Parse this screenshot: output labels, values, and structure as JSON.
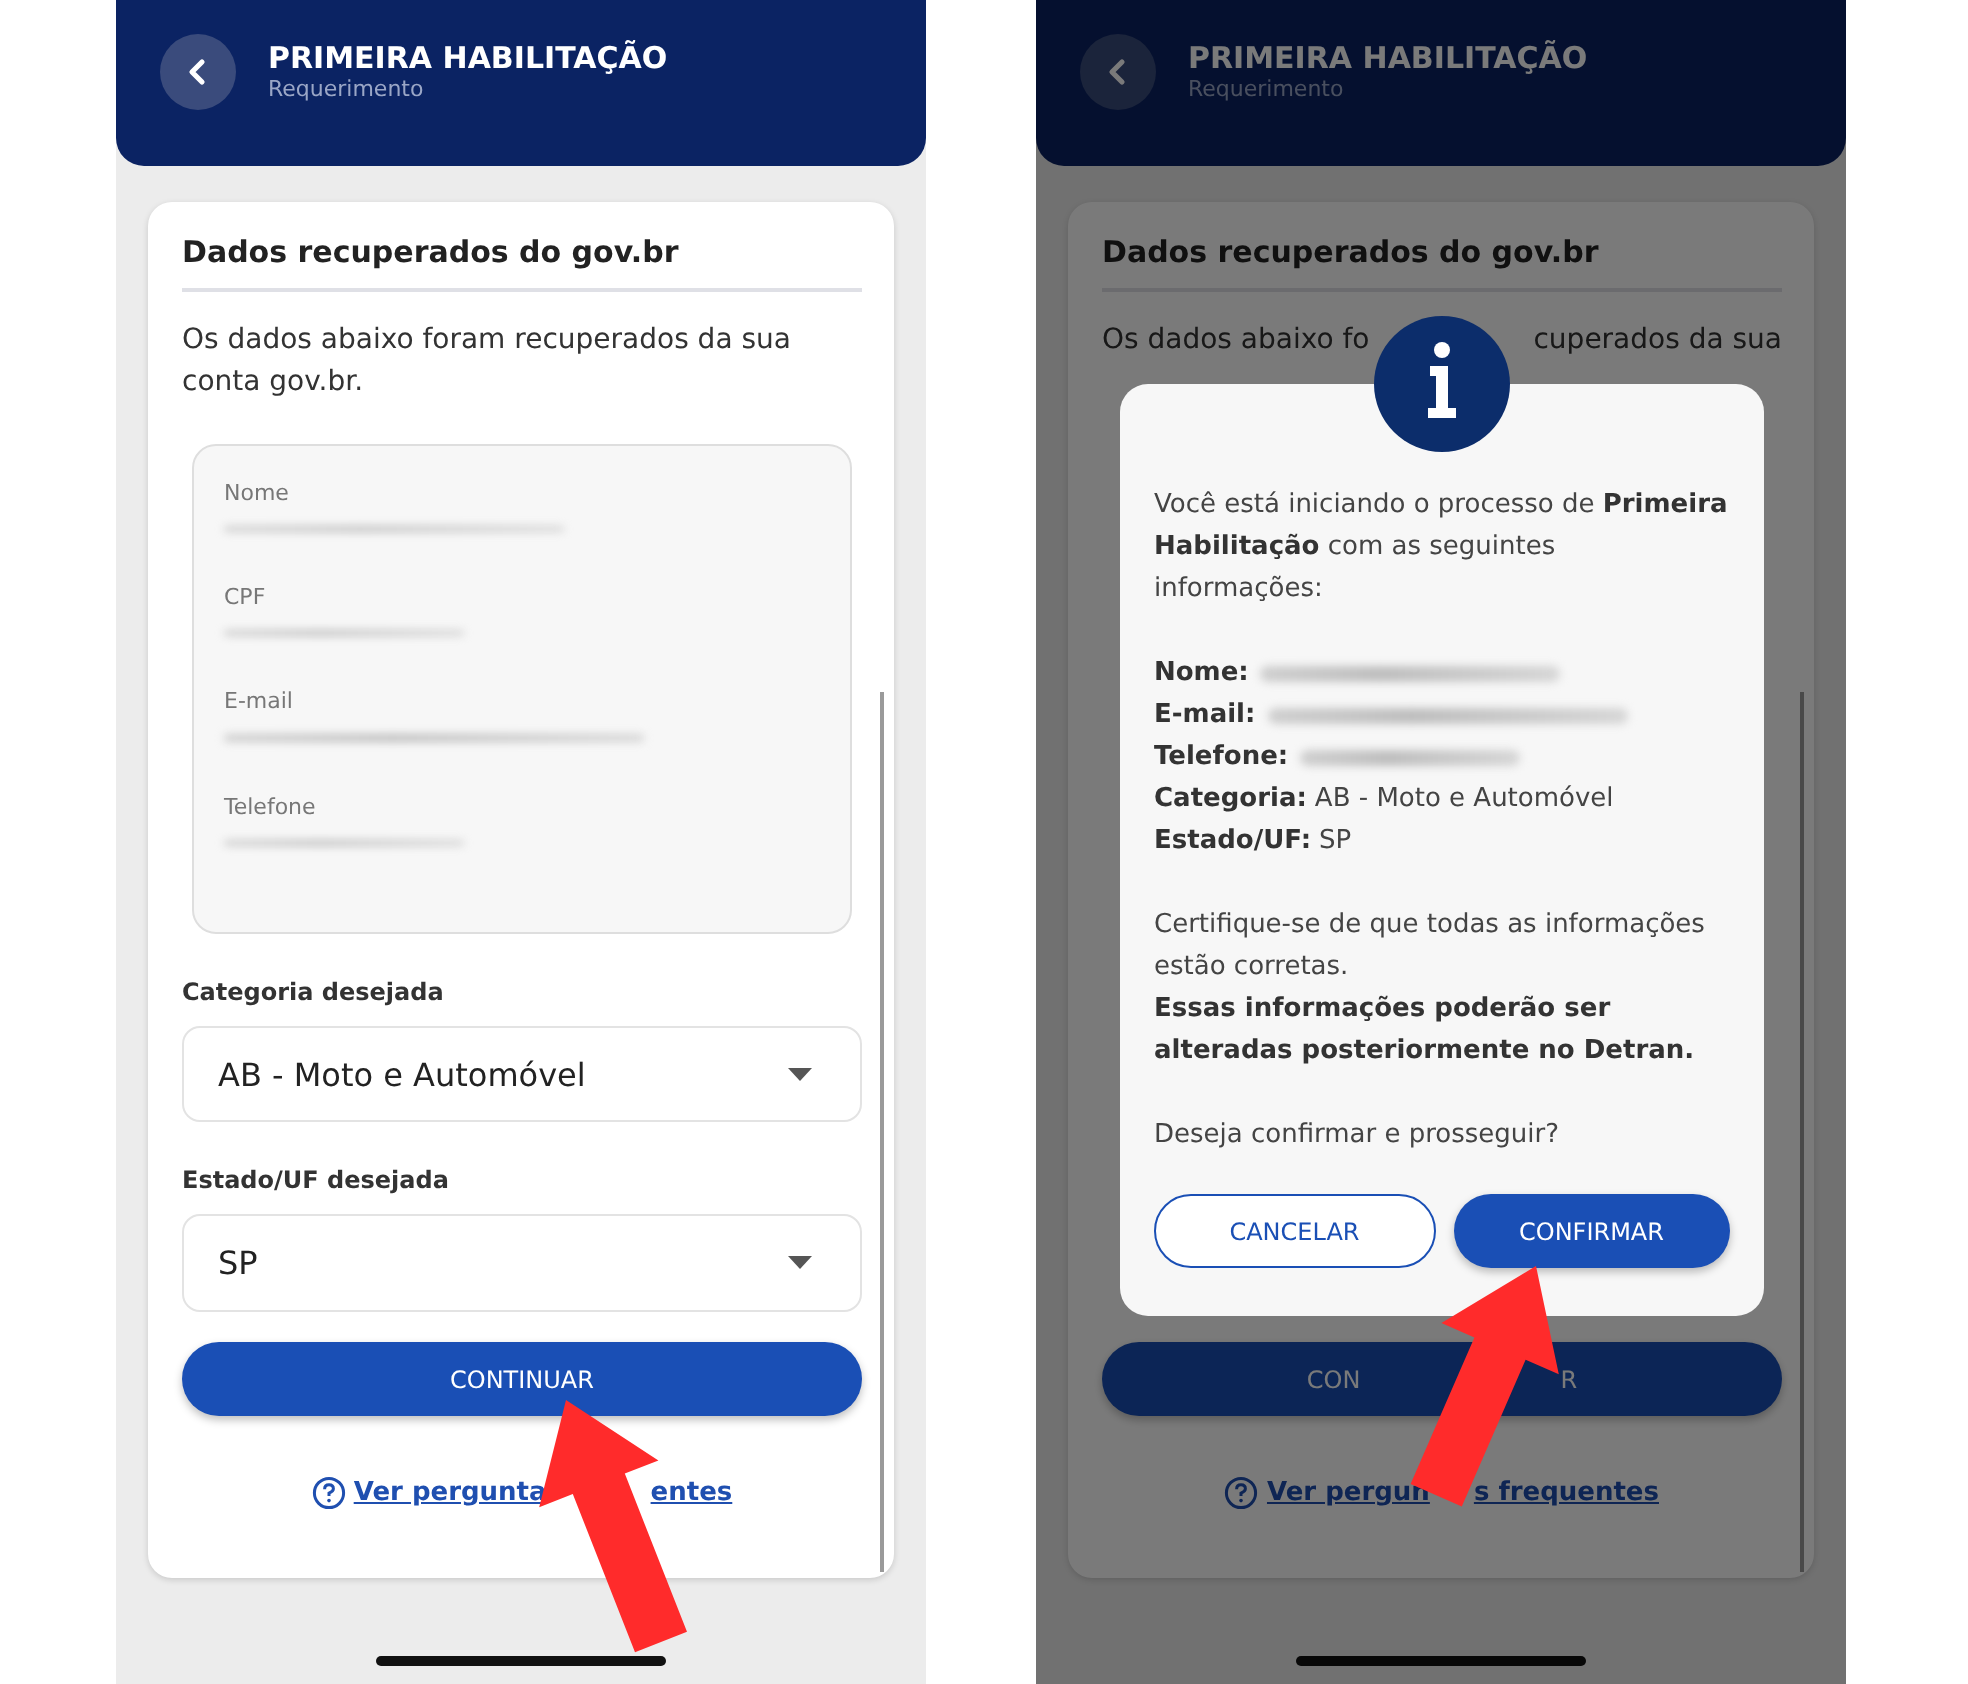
{
  "screens": [
    {
      "kind": "form",
      "header": {
        "title": "PRIMEIRA HABILITAÇÃO",
        "subtitle": "Requerimento"
      },
      "card": {
        "heading": "Dados recuperados do gov.br",
        "intro": "Os dados abaixo foram recuperados da sua conta gov.br.",
        "fields": [
          {
            "label": "Nome"
          },
          {
            "label": "CPF"
          },
          {
            "label": "E-mail"
          },
          {
            "label": "Telefone"
          }
        ],
        "selects": [
          {
            "label": "Categoria desejada",
            "value": "AB - Moto e Automóvel"
          },
          {
            "label": "Estado/UF desejada",
            "value": "SP"
          }
        ],
        "button": [
          "CONTINUAR"
        ],
        "link": [
          "Ver pergunta",
          "entes"
        ]
      }
    },
    {
      "kind": "dialog",
      "header": {
        "title": "PRIMEIRA HABILITAÇÃO",
        "subtitle": "Requerimento"
      },
      "card": {
        "heading": "Dados recuperados do gov.br",
        "intro_parts": [
          "Os dados abaixo fo",
          "cuperados da sua"
        ],
        "button": [
          "CON",
          "R"
        ],
        "link": [
          "Ver pergun",
          "s frequentes"
        ]
      },
      "dialog": {
        "intro": "Você está iniciando o processo de **Primeira Habilitação** com as seguintes informações:",
        "summary": [
          {
            "label": "Nome:",
            "kind": "redacted"
          },
          {
            "label": "E-mail:",
            "kind": "redacted"
          },
          {
            "label": "Telefone:",
            "kind": "redacted"
          },
          {
            "label": "Categoria:",
            "kind": "text",
            "value": "AB - Moto e Automóvel"
          },
          {
            "label": "Estado/UF:",
            "kind": "text",
            "value": "SP"
          }
        ],
        "note": "Certifique-se de que todas as informações estão corretas.",
        "warning": "Essas informações poderão ser alteradas posteriormente no Detran.",
        "question": "Deseja confirmar e prosseguir?",
        "buttons": [
          {
            "label": "CANCELAR",
            "kind": "secondary"
          },
          {
            "label": "CONFIRMAR",
            "kind": "primary"
          }
        ]
      }
    }
  ]
}
